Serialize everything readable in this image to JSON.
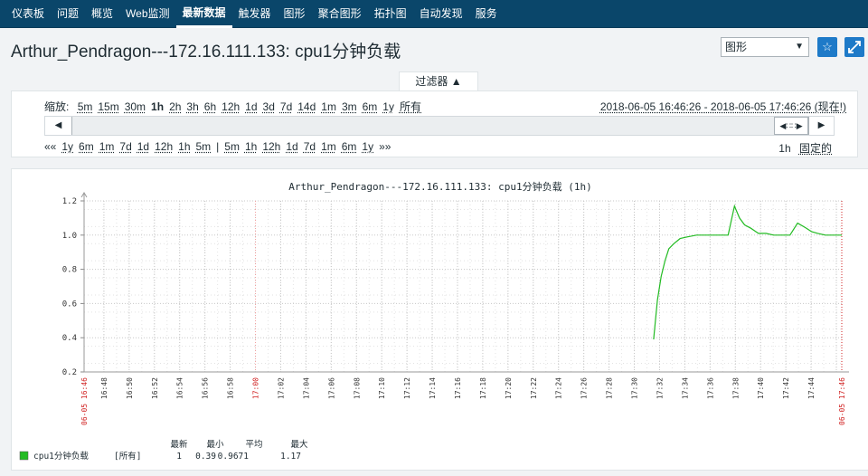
{
  "nav": {
    "items": [
      {
        "label": "仪表板",
        "active": false
      },
      {
        "label": "问题",
        "active": false
      },
      {
        "label": "概览",
        "active": false
      },
      {
        "label": "Web监测",
        "active": false
      },
      {
        "label": "最新数据",
        "active": true
      },
      {
        "label": "触发器",
        "active": false
      },
      {
        "label": "图形",
        "active": false
      },
      {
        "label": "聚合图形",
        "active": false
      },
      {
        "label": "拓扑图",
        "active": false
      },
      {
        "label": "自动发现",
        "active": false
      },
      {
        "label": "服务",
        "active": false
      }
    ]
  },
  "header": {
    "title": "Arthur_Pendragon---172.16.111.133: cpu1分钟负载",
    "view_select": "图形",
    "favorite_icon": "star-icon",
    "fullscreen_icon": "expand-icon"
  },
  "filter": {
    "tab_label": "过滤器 ▲",
    "zoom_label": "缩放:",
    "zoom_options": [
      "5m",
      "15m",
      "30m",
      "1h",
      "2h",
      "3h",
      "6h",
      "12h",
      "1d",
      "3d",
      "7d",
      "14d",
      "1m",
      "3m",
      "6m",
      "1y",
      "所有"
    ],
    "zoom_active": "1h",
    "period": "2018-06-05 16:46:26 - 2018-06-05 17:46:26 (现在!)",
    "back_prefix": "««",
    "back_links": [
      "1y",
      "6m",
      "1m",
      "7d",
      "1d",
      "12h",
      "1h",
      "5m"
    ],
    "separator": "|",
    "fwd_links": [
      "5m",
      "1h",
      "12h",
      "1d",
      "7d",
      "1m",
      "6m",
      "1y"
    ],
    "fwd_suffix": "»»",
    "period_length": "1h",
    "fixed_label": "固定的"
  },
  "graph": {
    "legend": {
      "headers": [
        "最新",
        "最小",
        "平均",
        "最大"
      ],
      "item_name": "cpu1分钟负载",
      "item_func": "[所有]",
      "values": [
        "1",
        "0.39",
        "0.9671",
        "1.17"
      ],
      "color": "#22bb22"
    }
  },
  "chart_data": {
    "type": "line",
    "title": "Arthur_Pendragon---172.16.111.133: cpu1分钟负载 (1h)",
    "ylim": [
      0.2,
      1.2
    ],
    "yticks": [
      "0.2",
      "0.4",
      "0.6",
      "0.8",
      "1.0",
      "1.2"
    ],
    "x_start_label": "06-05 16:46",
    "x_end_label": "06-05 17:46",
    "x_tick_labels": [
      "16:48",
      "16:50",
      "16:52",
      "16:54",
      "16:56",
      "16:58",
      "17:00",
      "17:02",
      "17:04",
      "17:06",
      "17:08",
      "17:10",
      "17:12",
      "17:14",
      "17:16",
      "17:18",
      "17:20",
      "17:22",
      "17:24",
      "17:26",
      "17:28",
      "17:30",
      "17:32",
      "17:34",
      "17:36",
      "17:38",
      "17:40",
      "17:42",
      "17:44",
      "17:46"
    ],
    "x_highlight_labels": [
      "17:00"
    ],
    "xlim_minutes": [
      0,
      60
    ],
    "series": [
      {
        "name": "cpu1分钟负载",
        "color": "#22bb22",
        "x_minutes": [
          45.1,
          45.4,
          45.7,
          46.0,
          46.3,
          46.7,
          47.2,
          47.8,
          48.5,
          49.2,
          50.0,
          51.0,
          51.5,
          51.9,
          52.3,
          52.8,
          53.4,
          54.0,
          54.6,
          55.2,
          55.9,
          56.5,
          57.2,
          57.6,
          58.1,
          58.7,
          59.3,
          60.0
        ],
        "y": [
          0.39,
          0.62,
          0.76,
          0.85,
          0.92,
          0.95,
          0.98,
          0.99,
          1.0,
          1.0,
          1.0,
          1.0,
          1.17,
          1.1,
          1.06,
          1.04,
          1.01,
          1.01,
          1.0,
          1.0,
          1.0,
          1.07,
          1.04,
          1.02,
          1.01,
          1.0,
          1.0,
          1.0
        ]
      }
    ]
  }
}
